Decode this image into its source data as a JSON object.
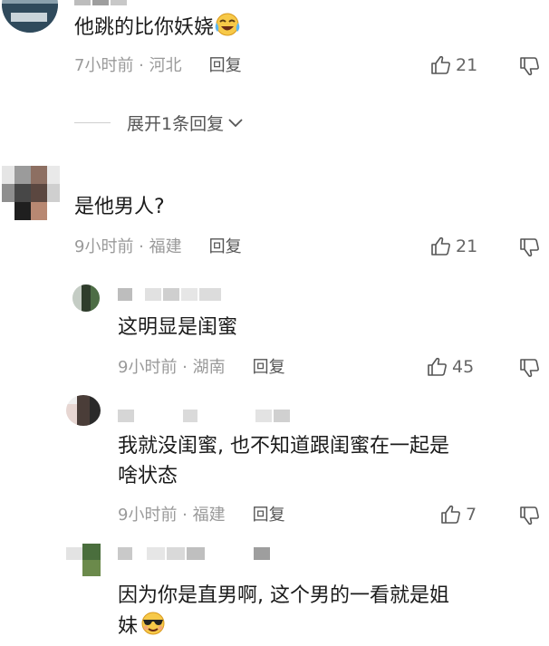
{
  "comments": [
    {
      "text": "他跳的比你妖娆",
      "emoji": "laughing-tears",
      "meta": "7小时前 · 河北",
      "reply": "回复",
      "likes": "21",
      "expand": "展开1条回复"
    },
    {
      "text": "是他男人?",
      "meta": "9小时前 · 福建",
      "reply": "回复",
      "likes": "21",
      "replies": [
        {
          "text": "这明显是闺蜜",
          "meta": "9小时前 · 湖南",
          "reply": "回复",
          "likes": "45"
        },
        {
          "text_line1": "我就没闺蜜, 也不知道跟闺蜜在一起是",
          "text_line2": "啥状态",
          "meta": "9小时前 · 福建",
          "reply": "回复",
          "likes": "7"
        },
        {
          "text_line1": "因为你是直男啊, 这个男的一看就是姐",
          "text_line2": "妹",
          "emoji": "cool-face"
        }
      ]
    }
  ],
  "colors": {
    "text": "#1b1b1b",
    "meta": "#9a9a9a",
    "reply": "#555555"
  }
}
